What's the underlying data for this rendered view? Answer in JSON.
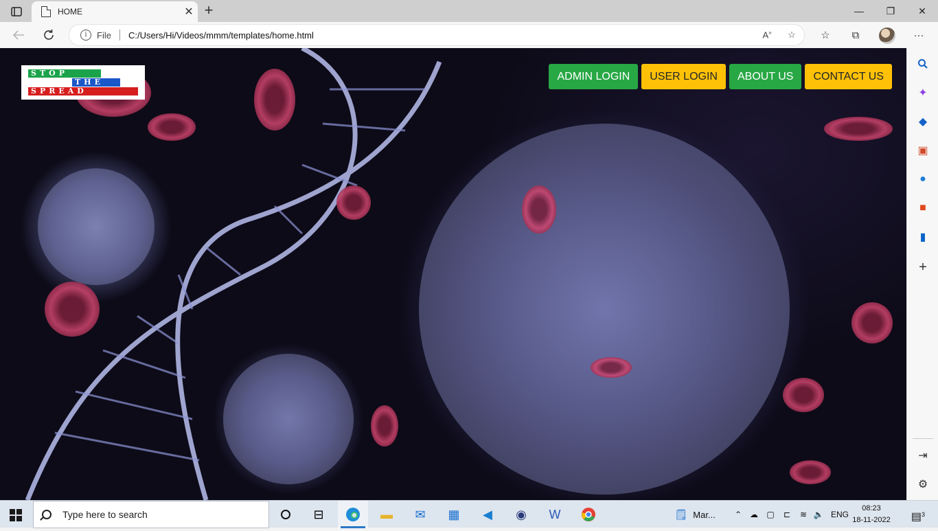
{
  "browser": {
    "tab_title": "HOME",
    "tab_close": "✕",
    "new_tab": "+",
    "window_controls": {
      "minimize": "—",
      "restore": "❐",
      "close": "✕"
    },
    "address": {
      "scheme_label": "File",
      "url": "C:/Users/Hi/Videos/mmm/templates/home.html"
    }
  },
  "page": {
    "logo": {
      "line1": "STOP",
      "line2": "THE",
      "line3": "SPREAD"
    },
    "nav": [
      {
        "label": "ADMIN LOGIN",
        "color": "#28a745"
      },
      {
        "label": "USER LOGIN",
        "color": "#ffc107"
      },
      {
        "label": "ABOUT US",
        "color": "#28a745"
      },
      {
        "label": "CONTACT US",
        "color": "#ffc107"
      }
    ]
  },
  "sidebar_icons": [
    "search-icon",
    "copilot-icon",
    "shopping-icon",
    "tools-icon",
    "games-icon",
    "office-icon",
    "outlook-icon",
    "add-icon",
    "hide-sidebar-icon",
    "settings-icon"
  ],
  "taskbar": {
    "search_placeholder": "Type here to search",
    "pinned_app_label": "Mar...",
    "language": "ENG",
    "time": "08:23",
    "date": "18-11-2022",
    "notification_count": "3"
  }
}
